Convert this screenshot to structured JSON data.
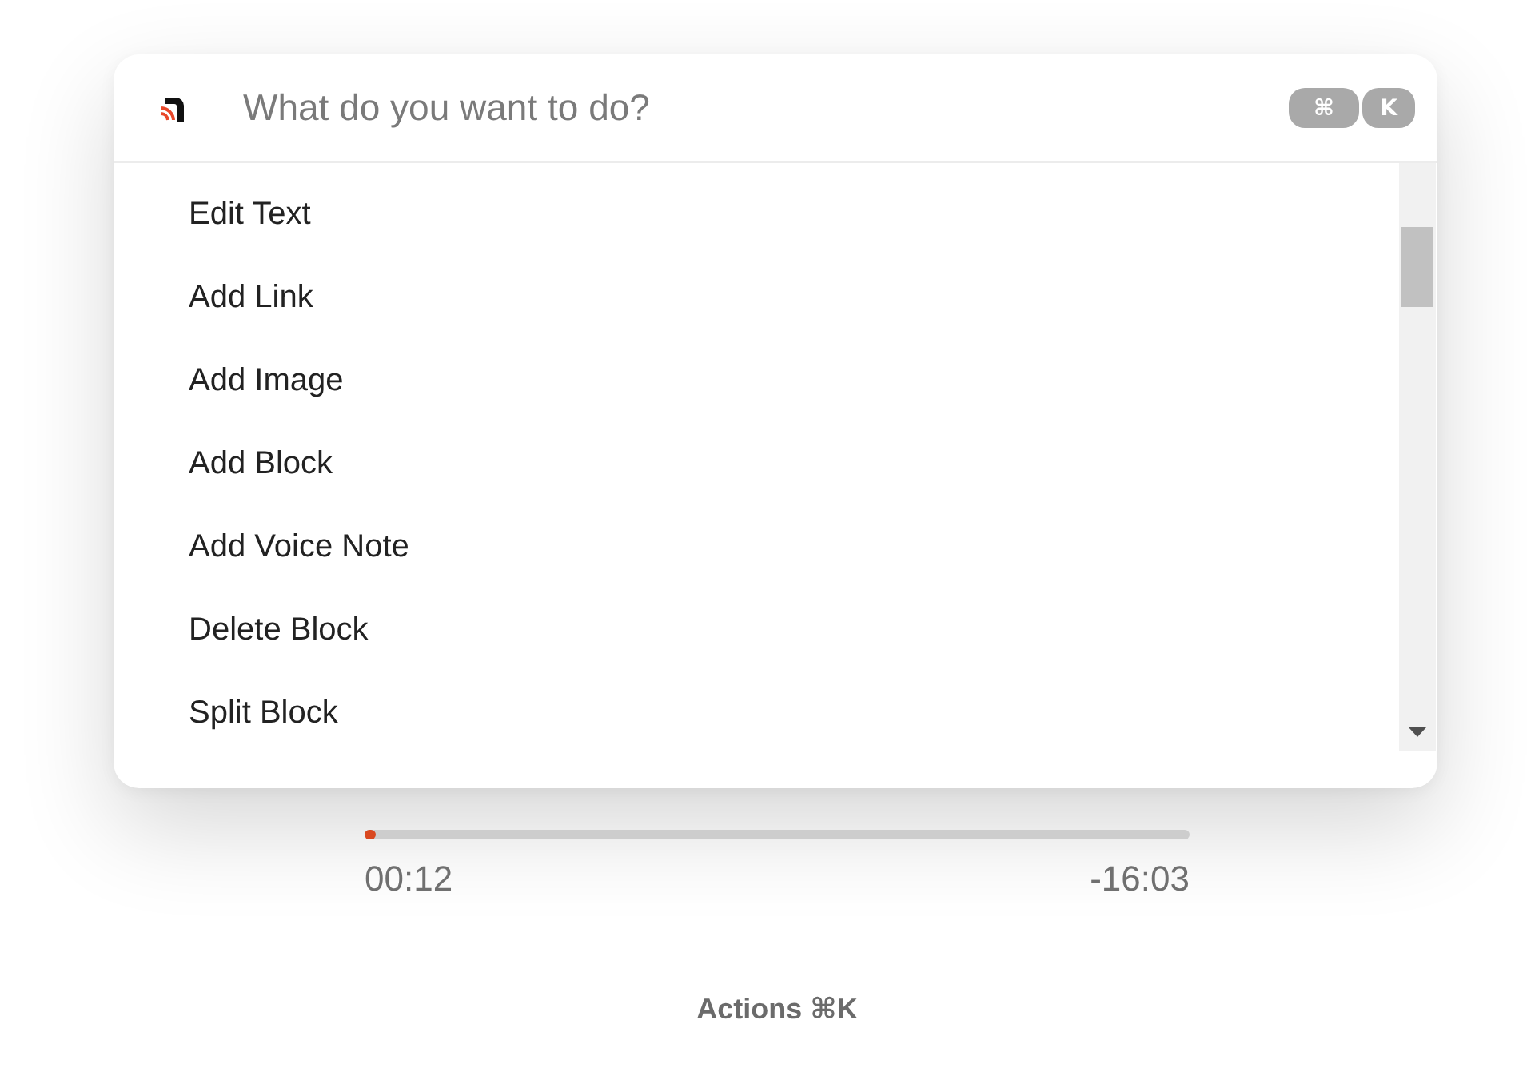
{
  "command_palette": {
    "search": {
      "placeholder": "What do you want to do?"
    },
    "shortcut_keys": [
      "⌘",
      "K"
    ],
    "actions": [
      "Edit Text",
      "Add Link",
      "Add Image",
      "Add Block",
      "Add Voice Note",
      "Delete Block",
      "Split Block"
    ]
  },
  "player": {
    "progress": {
      "level": 0.005
    },
    "elapsed": "00:12",
    "remaining": "-16:03"
  },
  "footer": {
    "label": "Actions ⌘K"
  }
}
